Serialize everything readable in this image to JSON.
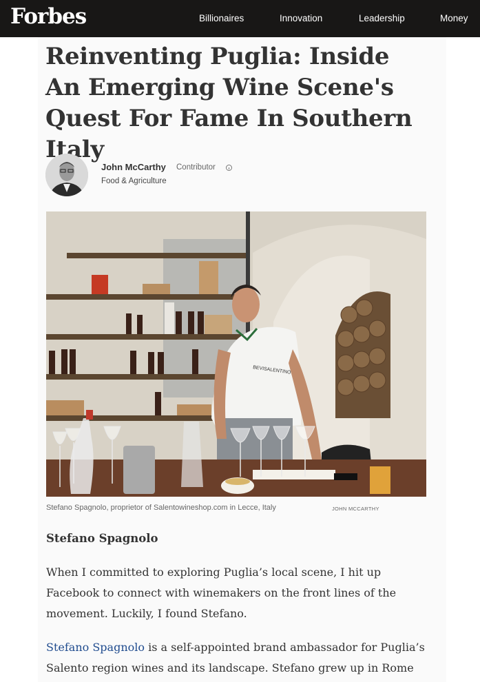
{
  "header": {
    "logo": "Forbes",
    "nav": [
      "Billionaires",
      "Innovation",
      "Leadership",
      "Money"
    ]
  },
  "article": {
    "headline": "Reinventing Puglia: Inside An Emerging Wine Scene's Quest For Fame In Southern Italy",
    "author": "John McCarthy",
    "author_role": "Contributor",
    "channel": "Food & Agriculture",
    "shirt_logo": "BEVISALENTINO",
    "caption": "Stefano Spagnolo, proprietor of Salentowineshop.com in Lecce, Italy",
    "credit": "JOHN MCCARTHY",
    "subhead": "Stefano Spagnolo",
    "para1": "When I committed to exploring Puglia’s local scene, I hit up Facebook to connect with winemakers on the front lines of the movement. Luckily, I found Stefano.",
    "para2_link": "Stefano Spagnolo",
    "para2_rest": " is a self-appointed brand ambassador for Puglia’s Salento region wines and its landscape. Stefano grew up in Rome and"
  },
  "colors": {
    "nav_bg": "#181716",
    "link": "#1f4b8e",
    "text": "#333333"
  }
}
